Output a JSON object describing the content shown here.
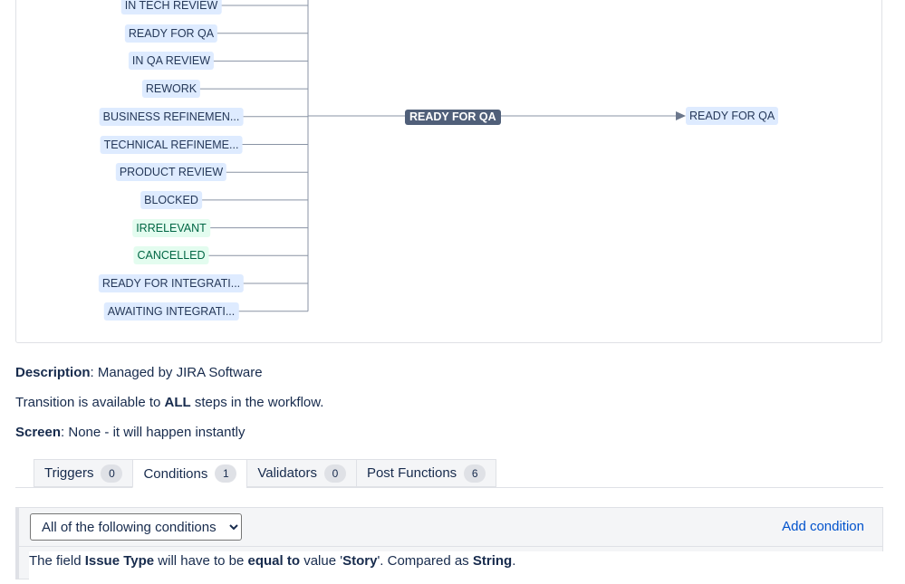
{
  "workflow": {
    "source_statuses": [
      {
        "label": "IN TECH REVIEW",
        "category": "blue"
      },
      {
        "label": "READY FOR QA",
        "category": "blue"
      },
      {
        "label": "IN QA REVIEW",
        "category": "blue"
      },
      {
        "label": "REWORK",
        "category": "blue"
      },
      {
        "label": "BUSINESS REFINEMEN...",
        "category": "blue"
      },
      {
        "label": "TECHNICAL REFINEME...",
        "category": "blue"
      },
      {
        "label": "PRODUCT REVIEW",
        "category": "blue"
      },
      {
        "label": "BLOCKED",
        "category": "blue"
      },
      {
        "label": "IRRELEVANT",
        "category": "green"
      },
      {
        "label": "CANCELLED",
        "category": "green"
      },
      {
        "label": "READY FOR INTEGRATI...",
        "category": "blue"
      },
      {
        "label": "AWAITING INTEGRATI...",
        "category": "blue"
      }
    ],
    "transition_name": "READY FOR QA",
    "target_status": "READY FOR QA",
    "colors": {
      "line": "#8993a4",
      "transition_bg": "#505f79",
      "status_blue_bg": "#deebff",
      "status_green_bg": "#e3fcef"
    }
  },
  "details": {
    "description_label": "Description",
    "description_value": ": Managed by JIRA Software",
    "availability_prefix": "Transition is available to ",
    "availability_emphasis": "ALL",
    "availability_suffix": " steps in the workflow.",
    "screen_label": "Screen",
    "screen_value": ": None - it will happen instantly"
  },
  "tabs": [
    {
      "label": "Triggers",
      "count": "0",
      "active": false
    },
    {
      "label": "Conditions",
      "count": "1",
      "active": true
    },
    {
      "label": "Validators",
      "count": "0",
      "active": false
    },
    {
      "label": "Post Functions",
      "count": "6",
      "active": false
    }
  ],
  "conditions": {
    "selected_option": "All of the following conditions",
    "add_label": "Add condition",
    "rule": {
      "p1": "The field ",
      "field": "Issue Type",
      "p2": " will have to be ",
      "op": "equal to",
      "p3": " value '",
      "value": "Story",
      "p4": "'. Compared as ",
      "type": "String",
      "p5": "."
    }
  }
}
